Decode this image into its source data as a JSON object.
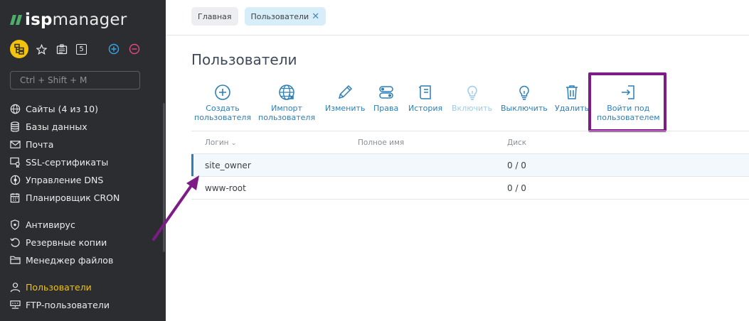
{
  "brand": {
    "prefix": "isp",
    "name": "manager"
  },
  "sidebar": {
    "quick_badge": "5",
    "search_placeholder": "Ctrl + Shift + M",
    "items": [
      {
        "label": "Сайты (4 из 10)",
        "icon": "globe-icon"
      },
      {
        "label": "Базы данных",
        "icon": "database-icon"
      },
      {
        "label": "Почта",
        "icon": "mail-icon"
      },
      {
        "label": "SSL-сертификаты",
        "icon": "certificate-icon"
      },
      {
        "label": "Управление DNS",
        "icon": "dns-icon"
      },
      {
        "label": "Планировщик CRON",
        "icon": "calendar-icon"
      },
      {
        "label": "Антивирус",
        "icon": "shield-icon"
      },
      {
        "label": "Резервные копии",
        "icon": "backup-icon"
      },
      {
        "label": "Менеджер файлов",
        "icon": "folder-icon"
      },
      {
        "label": "Пользователи",
        "icon": "user-icon",
        "active": true
      },
      {
        "label": "FTP-пользователи",
        "icon": "ftp-icon"
      }
    ]
  },
  "breadcrumbs": [
    {
      "label": "Главная"
    },
    {
      "label": "Пользователи",
      "closable": true
    }
  ],
  "page": {
    "title": "Пользователи"
  },
  "toolbar": {
    "create": {
      "line1": "Создать",
      "line2": "пользователя"
    },
    "import": {
      "line1": "Импорт",
      "line2": "пользователя"
    },
    "edit": "Изменить",
    "rights": "Права",
    "history": "История",
    "enable": "Включить",
    "disable": "Выключить",
    "delete": "Удалить",
    "login_as": {
      "line1": "Войти под",
      "line2": "пользователем"
    }
  },
  "table": {
    "headers": {
      "login": "Логин",
      "fullname": "Полное имя",
      "disk": "Диск"
    },
    "rows": [
      {
        "login": "site_owner",
        "fullname": "",
        "disk": "0 / 0",
        "selected": true
      },
      {
        "login": "www-root",
        "fullname": "",
        "disk": "0 / 0",
        "selected": false
      }
    ]
  },
  "colors": {
    "sidebar_bg": "#2b2d31",
    "accent_yellow": "#f4c20d",
    "link_blue": "#2c7fb8",
    "annotation_purple": "#7e1b87"
  }
}
